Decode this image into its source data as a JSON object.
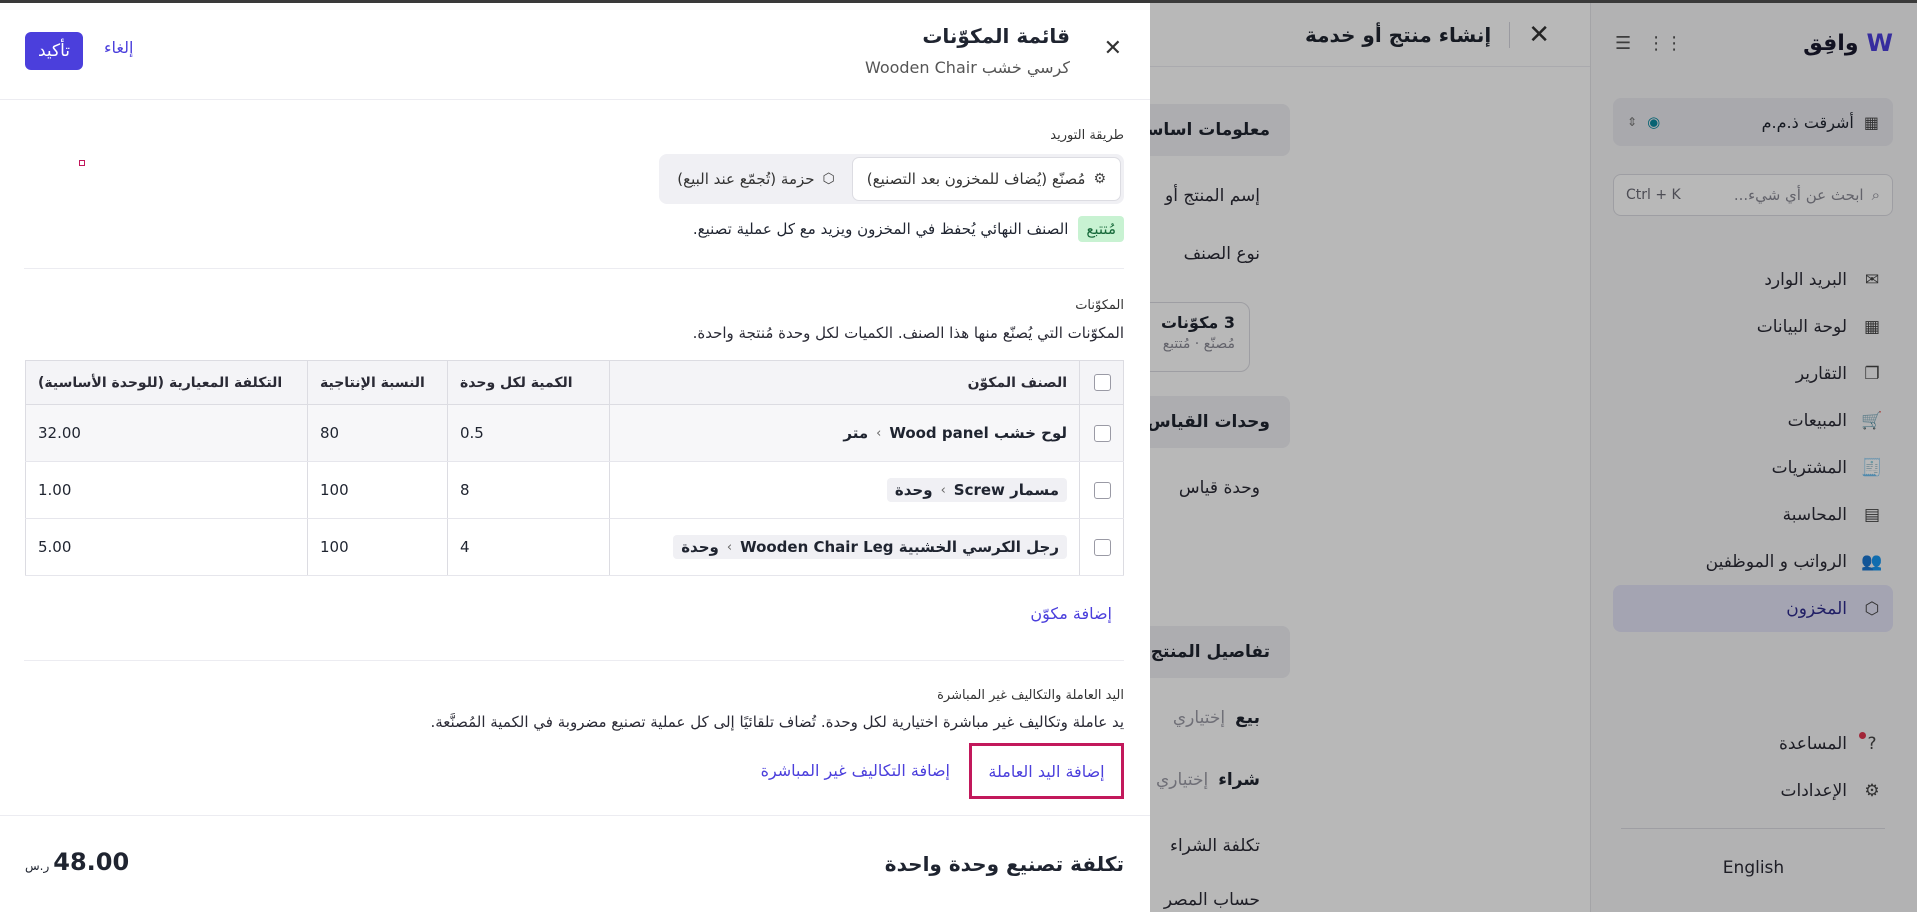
{
  "app": {
    "logo_text": "وافِق",
    "org_name": "أشرقت ذ.م.م",
    "search_placeholder": "ابحث عن أي شيء...",
    "search_shortcut": "Ctrl + K",
    "nav": [
      {
        "label": "البريد الوارد",
        "icon": "inbox-icon",
        "glyph": "✉"
      },
      {
        "label": "لوحة البيانات",
        "icon": "dashboard-icon",
        "glyph": "▦"
      },
      {
        "label": "التقارير",
        "icon": "reports-icon",
        "glyph": "❐"
      },
      {
        "label": "المبيعات",
        "icon": "cart-icon",
        "glyph": "🛒"
      },
      {
        "label": "المشتريات",
        "icon": "receipt-icon",
        "glyph": "🧾"
      },
      {
        "label": "المحاسبة",
        "icon": "ledger-icon",
        "glyph": "▤"
      },
      {
        "label": "الرواتب و الموظفين",
        "icon": "people-icon",
        "glyph": "👥"
      },
      {
        "label": "المخزون",
        "icon": "box-icon",
        "glyph": "⬡",
        "active": true
      }
    ],
    "help_label": "المساعدة",
    "settings_label": "الإعدادات",
    "language_label": "English"
  },
  "create_panel": {
    "title": "إنشاء منتج أو خدمة",
    "basic_info_label": "معلومات اساسية",
    "product_name_label": "إسم المنتج أو",
    "item_type_label": "نوع الصنف",
    "components_card_title": "3 مكوّنات",
    "components_card_sub": "مُصنّع · مُتتبع",
    "uom_section_label": "وحدات القياس",
    "uom_label": "وحدة قياس",
    "details_section_label": "تفاصيل المنتج أ",
    "sell_label": "بيع",
    "sell_optional": "إختياري",
    "buy_label": "شراء",
    "buy_optional": "إختياري",
    "purchase_cost_label": "تكلفة الشراء",
    "expense_account_label": "حساب المصر"
  },
  "bom_modal": {
    "title": "قائمة المكوّنات",
    "subtitle": "كرسي خشب Wooden Chair",
    "confirm_label": "تأكيد",
    "cancel_label": "إلغاء",
    "supply_method_label": "طريقة التوريد",
    "supply_options": [
      {
        "label": "مُصنّع (يُضاف للمخزون بعد التصنيع)",
        "icon": "factory-icon",
        "selected": true
      },
      {
        "label": "حزمة (تُجمّع عند البيع)",
        "icon": "package-icon",
        "selected": false
      }
    ],
    "tracked_badge": "مُتتبع",
    "tracked_desc": "الصنف النهائي يُحفظ في المخزون ويزيد مع كل عملية تصنيع.",
    "components_label": "المكوّنات",
    "components_desc": "المكوّنات التي يُصنّع منها هذا الصنف. الكميات لكل وحدة مُنتجة واحدة.",
    "table": {
      "headers": [
        "الصنف المكوّن",
        "الكمية لكل وحدة",
        "النسبة الإنتاجية",
        "التكلفة المعيارية (للوحدة الأساسية)"
      ],
      "rows": [
        {
          "item": "لوح خشب Wood panel",
          "unit": "متر",
          "qty": "0.5",
          "yield": "80",
          "cost": "32.00"
        },
        {
          "item": "مسمار Screw",
          "unit": "وحدة",
          "qty": "8",
          "yield": "100",
          "cost": "1.00"
        },
        {
          "item": "رجل الكرسي الخشبية Wooden Chair Leg",
          "unit": "وحدة",
          "qty": "4",
          "yield": "100",
          "cost": "5.00"
        }
      ]
    },
    "add_component_label": "إضافة مكوّن",
    "labor_label": "اليد العاملة والتكاليف غير المباشرة",
    "labor_desc": "يد عاملة وتكاليف غير مباشرة اختيارية لكل وحدة. تُضاف تلقائيًا إلى كل عملية تصنيع مضروبة في الكمية المُصنَّعة.",
    "add_labor_label": "إضافة اليد العاملة",
    "add_overhead_label": "إضافة التكاليف غير المباشرة",
    "unit_cost_label": "تكلفة تصنيع وحدة واحدة",
    "unit_cost_value": "48.00",
    "currency_symbol": "ر.س"
  }
}
